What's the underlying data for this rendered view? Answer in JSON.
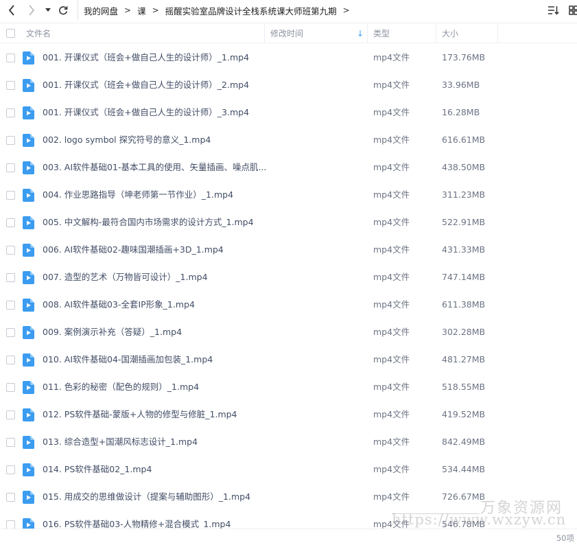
{
  "breadcrumb": [
    "我的网盘",
    "课",
    "摇醒实验室品牌设计全栈系统课大师班第九期"
  ],
  "breadcrumb_separator": ">",
  "columns": {
    "name": "文件名",
    "modified": "修改时间",
    "type": "类型",
    "size": "大小"
  },
  "sort_indicator": "↓",
  "files": [
    {
      "name": "001. 开课仪式（班会+做自己人生的设计师）_1.mp4",
      "type": "mp4文件",
      "size": "173.76MB"
    },
    {
      "name": "001. 开课仪式（班会+做自己人生的设计师）_2.mp4",
      "type": "mp4文件",
      "size": "33.96MB"
    },
    {
      "name": "001. 开课仪式（班会+做自己人生的设计师）_3.mp4",
      "type": "mp4文件",
      "size": "16.28MB"
    },
    {
      "name": "002. logo symbol 探究符号的意义_1.mp4",
      "type": "mp4文件",
      "size": "616.61MB"
    },
    {
      "name": "003. AI软件基础01-基本工具的使用、矢量插画、噪点肌...",
      "type": "mp4文件",
      "size": "438.50MB"
    },
    {
      "name": "004. 作业思路指导（坤老师第一节作业）_1.mp4",
      "type": "mp4文件",
      "size": "311.23MB"
    },
    {
      "name": "005. 中文解构-最符合国内市场需求的设计方式_1.mp4",
      "type": "mp4文件",
      "size": "522.91MB"
    },
    {
      "name": "006. AI软件基础02-趣味国潮插画+3D_1.mp4",
      "type": "mp4文件",
      "size": "431.33MB"
    },
    {
      "name": "007. 造型的艺术（万物皆可设计）_1.mp4",
      "type": "mp4文件",
      "size": "747.14MB"
    },
    {
      "name": "008. AI软件基础03-全套IP形象_1.mp4",
      "type": "mp4文件",
      "size": "611.38MB"
    },
    {
      "name": "009. 案例演示补充（答疑）_1.mp4",
      "type": "mp4文件",
      "size": "302.28MB"
    },
    {
      "name": "010. AI软件基础04-国潮插画加包装_1.mp4",
      "type": "mp4文件",
      "size": "481.27MB"
    },
    {
      "name": "011. 色彩的秘密（配色的规则）_1.mp4",
      "type": "mp4文件",
      "size": "518.55MB"
    },
    {
      "name": "012. PS软件基础-蒙版+人物的修型与修脏_1.mp4",
      "type": "mp4文件",
      "size": "419.52MB"
    },
    {
      "name": "013. 综合造型+国潮风标志设计_1.mp4",
      "type": "mp4文件",
      "size": "842.49MB"
    },
    {
      "name": "014. PS软件基础02_1.mp4",
      "type": "mp4文件",
      "size": "534.44MB"
    },
    {
      "name": "015. 用成交的思维做设计（提案与辅助图形）_1.mp4",
      "type": "mp4文件",
      "size": "726.67MB"
    },
    {
      "name": "016. PS软件基础03-人物精修+混合模式_1.mp4",
      "type": "mp4文件",
      "size": "546.78MB"
    }
  ],
  "footer": {
    "item_count": "50项"
  },
  "watermark": {
    "text": "万象资源网",
    "url": "https://www.wxzyw.cn"
  },
  "colors": {
    "accent": "#3b9cf0",
    "text": "#414d65",
    "muted": "#8d93a0"
  },
  "icons": [
    "back-arrow-icon",
    "forward-arrow-icon",
    "dropdown-icon",
    "refresh-icon",
    "sort-list-icon",
    "grid-view-icon",
    "video-file-icon"
  ]
}
